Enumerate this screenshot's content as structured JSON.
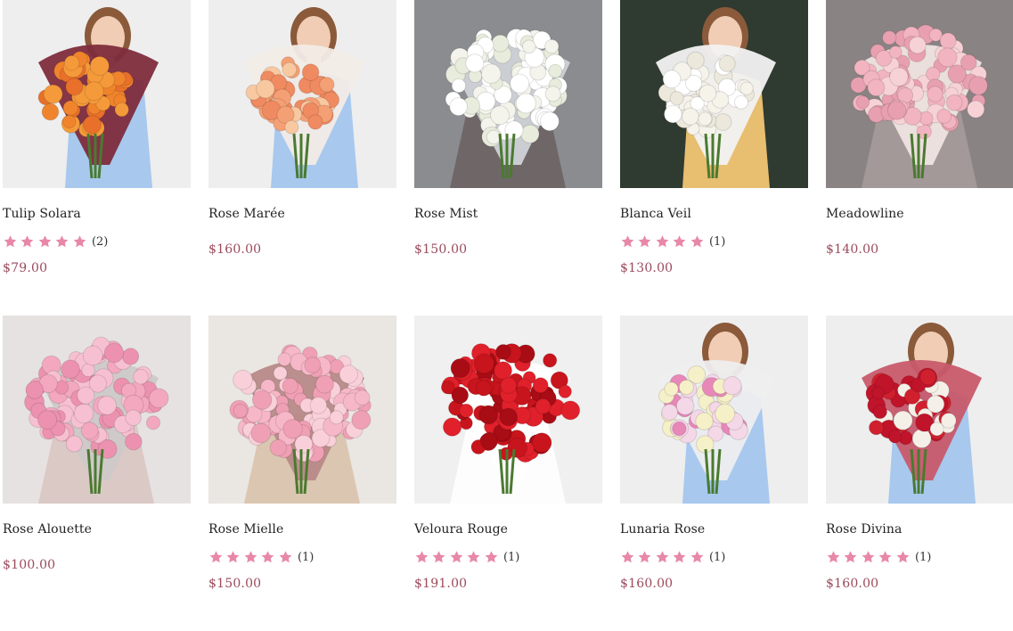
{
  "colors": {
    "accent": "#e888a8",
    "price": "#9a4a5b",
    "text": "#222222"
  },
  "products": [
    {
      "name": "Tulip Solara",
      "rating_count": "(2)",
      "rating": 5,
      "price": "$79.00",
      "bg": "#eeeeee",
      "dress": "#a8c8ee",
      "wrap": "#7e2c3c",
      "flowers": [
        "#f0842c",
        "#f59a3a",
        "#e8702a"
      ],
      "person": true
    },
    {
      "name": "Rose Marée",
      "rating_count": null,
      "price": "$160.00",
      "bg": "#eeeeee",
      "dress": "#a8c8ee",
      "wrap": "#f2ece6",
      "flowers": [
        "#f4a074",
        "#f8c8a0",
        "#f08a60"
      ],
      "person": true
    },
    {
      "name": "Rose Mist",
      "rating_count": null,
      "price": "$150.00",
      "bg": "#8a8c90",
      "dress": "#6a6060",
      "wrap": "#cfd3d8",
      "flowers": [
        "#f4f4ec",
        "#e8ecdc",
        "#ffffff"
      ],
      "person": false
    },
    {
      "name": "Blanca Veil",
      "rating_count": "(1)",
      "rating": 5,
      "price": "$130.00",
      "bg": "#2f3a30",
      "dress": "#e8be70",
      "wrap": "#f2f2f2",
      "flowers": [
        "#f6f3ea",
        "#ece8dc",
        "#ffffff"
      ],
      "person": true
    },
    {
      "name": "Meadowline",
      "rating_count": null,
      "price": "$140.00",
      "bg": "#8a8384",
      "dress": "#a89e9c",
      "wrap": "#efe4e0",
      "flowers": [
        "#f2b4c0",
        "#f6d2d6",
        "#e8a0b0"
      ],
      "person": false
    },
    {
      "name": "Rose Alouette",
      "rating_count": null,
      "price": "$100.00",
      "bg": "#e6e2e2",
      "dress": "#d8c4c0",
      "wrap": "#cfc9c9",
      "flowers": [
        "#f3a8c0",
        "#f7c0d2",
        "#ec92b0"
      ],
      "person": false
    },
    {
      "name": "Rose Mielle",
      "rating_count": "(1)",
      "rating": 5,
      "price": "$150.00",
      "bg": "#eae6e2",
      "dress": "#d8c0a8",
      "wrap": "#b88a88",
      "flowers": [
        "#f6b8c8",
        "#f9d0da",
        "#f0a0b4"
      ],
      "person": false
    },
    {
      "name": "Veloura Rouge",
      "rating_count": "(1)",
      "rating": 5,
      "price": "$191.00",
      "bg": "#f0f0f0",
      "dress": "#ffffff",
      "wrap": "#ffffff",
      "flowers": [
        "#c8141c",
        "#e0202a",
        "#a80c14"
      ],
      "person": false
    },
    {
      "name": "Lunaria Rose",
      "rating_count": "(1)",
      "rating": 5,
      "price": "$160.00",
      "bg": "#eeeeee",
      "dress": "#a8c8ee",
      "wrap": "#eeeeee",
      "flowers": [
        "#f6f0c8",
        "#e888b8",
        "#f4d8e8"
      ],
      "person": true
    },
    {
      "name": "Rose Divina",
      "rating_count": "(1)",
      "rating": 5,
      "price": "$160.00",
      "bg": "#eeeeee",
      "dress": "#a8c8ee",
      "wrap": "#c85a6a",
      "flowers": [
        "#c0142a",
        "#f4f0e8",
        "#d0202e"
      ],
      "person": true
    }
  ]
}
